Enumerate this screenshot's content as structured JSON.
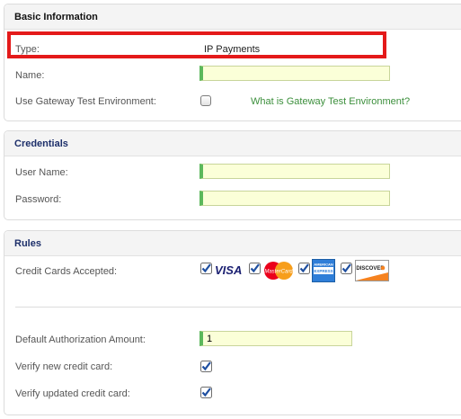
{
  "basic": {
    "title": "Basic Information",
    "type_label": "Type:",
    "type_value": "IP Payments",
    "name_label": "Name:",
    "name_value": "",
    "test_env_label": "Use Gateway Test Environment:",
    "test_env_checked": false,
    "test_env_help_link": "What is Gateway Test Environment?"
  },
  "credentials": {
    "title": "Credentials",
    "username_label": "User Name:",
    "username_value": "",
    "password_label": "Password:",
    "password_value": ""
  },
  "rules": {
    "title": "Rules",
    "cards_label": "Credit Cards Accepted:",
    "cards": [
      {
        "name": "visa-icon",
        "label": "VISA",
        "checked": true
      },
      {
        "name": "mastercard-icon",
        "label": "MasterCard",
        "checked": true
      },
      {
        "name": "amex-icon",
        "label": "AMERICAN EXPRESS",
        "checked": true
      },
      {
        "name": "discover-icon",
        "label": "DISCOVER",
        "checked": true
      }
    ],
    "default_auth_label": "Default Authorization Amount:",
    "default_auth_value": "1",
    "verify_new_label": "Verify new credit card:",
    "verify_new_checked": true,
    "verify_updated_label": "Verify updated credit card:",
    "verify_updated_checked": true
  },
  "colors": {
    "highlight_border": "#e41a1a",
    "input_background": "#fbffd8",
    "required_indicator": "#5cb85c",
    "link": "#3c8f3c",
    "checkmark": "#1f4fa0"
  }
}
